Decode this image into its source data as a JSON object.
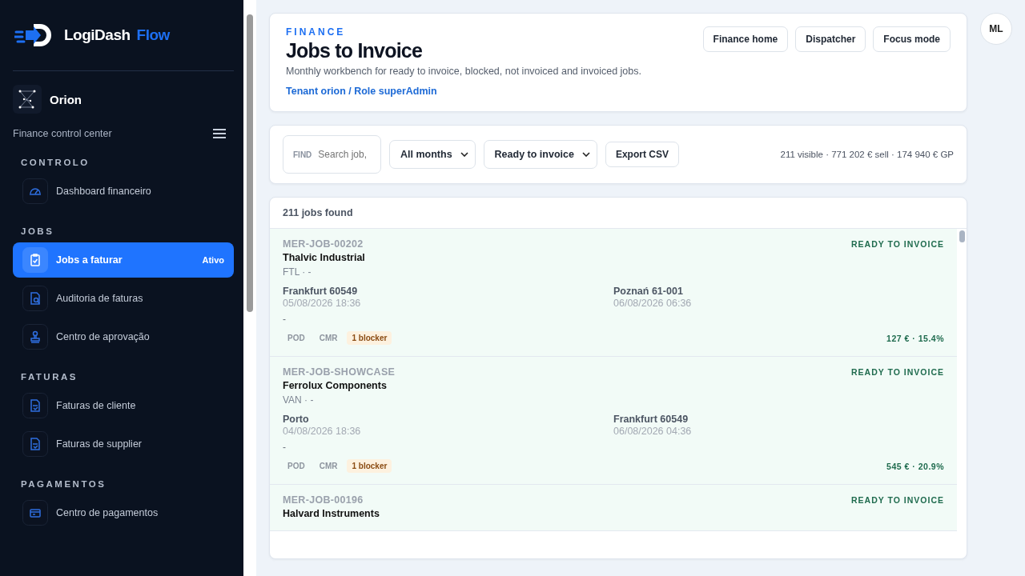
{
  "brand": {
    "name": "LogiDash",
    "accent": "Flow"
  },
  "tenant": {
    "name": "Orion",
    "subtitle": "Finance control center"
  },
  "sidebar": {
    "sections": [
      {
        "title": "CONTROLO",
        "items": [
          {
            "label": "Dashboard financeiro",
            "selected": false
          }
        ]
      },
      {
        "title": "JOBS",
        "items": [
          {
            "label": "Jobs a faturar",
            "selected": true,
            "badge": "Ativo"
          },
          {
            "label": "Auditoria de faturas",
            "selected": false
          },
          {
            "label": "Centro de aprovação",
            "selected": false
          }
        ]
      },
      {
        "title": "FATURAS",
        "items": [
          {
            "label": "Faturas de cliente",
            "selected": false
          },
          {
            "label": "Faturas de supplier",
            "selected": false
          }
        ]
      },
      {
        "title": "PAGAMENTOS",
        "items": [
          {
            "label": "Centro de pagamentos",
            "selected": false
          }
        ]
      }
    ]
  },
  "header": {
    "eyebrow": "FINANCE",
    "title": "Jobs to Invoice",
    "description": "Monthly workbench for ready to invoice, blocked, not invoiced and invoiced jobs.",
    "context_link": "Tenant orion / Role superAdmin",
    "buttons": [
      "Finance home",
      "Dispatcher",
      "Focus mode"
    ]
  },
  "filters": {
    "find_label": "FIND",
    "search_placeholder": "Search job,",
    "month_select": "All months",
    "status_select": "Ready to invoice",
    "export_button": "Export CSV",
    "summary": "211 visible · 771 202 € sell · 174 940 € GP"
  },
  "jobs": {
    "count": "211 jobs found",
    "rows": [
      {
        "id": "MER-JOB-00202",
        "client": "Thalvic Industrial",
        "mode": "FTL · -",
        "status": "READY TO INVOICE",
        "origin": "Frankfurt 60549",
        "origin_time": "05/08/2026 18:36",
        "destination": "Poznań 61-001",
        "destination_time": "06/08/2026 06:36",
        "note": "-",
        "docs": [
          "POD",
          "CMR"
        ],
        "blocker": "1 blocker",
        "margin": "127 € · 15.4%"
      },
      {
        "id": "MER-JOB-SHOWCASE",
        "client": "Ferrolux Components",
        "mode": "VAN · -",
        "status": "READY TO INVOICE",
        "origin": "Porto",
        "origin_time": "04/08/2026 18:36",
        "destination": "Frankfurt 60549",
        "destination_time": "06/08/2026 04:36",
        "note": "-",
        "docs": [
          "POD",
          "CMR"
        ],
        "blocker": "1 blocker",
        "margin": "545 € · 20.9%"
      },
      {
        "id": "MER-JOB-00196",
        "client": "Halvard Instruments",
        "status": "READY TO INVOICE"
      }
    ]
  },
  "user": {
    "initials": "ML"
  }
}
